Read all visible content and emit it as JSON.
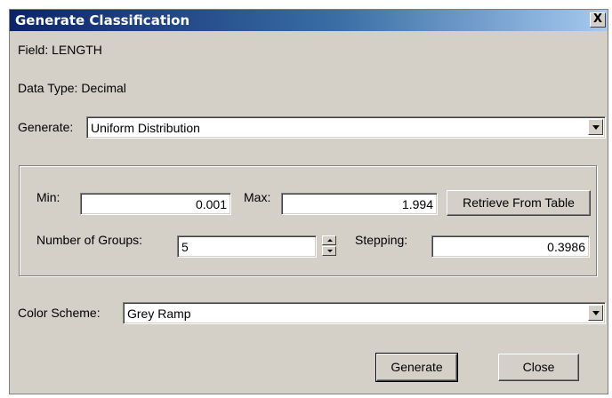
{
  "window": {
    "title": "Generate Classification",
    "close_glyph": "X"
  },
  "field_info": {
    "field": "Field: LENGTH",
    "data_type": "Data Type: Decimal"
  },
  "generate": {
    "label": "Generate:",
    "selected": "Uniform Distribution"
  },
  "range": {
    "min_label": "Min:",
    "min_value": "0.001",
    "max_label": "Max:",
    "max_value": "1.994",
    "retrieve_label": "Retrieve From Table",
    "groups_label": "Number of Groups:",
    "groups_value": "5",
    "stepping_label": "Stepping:",
    "stepping_value": "0.3986"
  },
  "color_scheme": {
    "label": "Color Scheme:",
    "selected": "Grey Ramp"
  },
  "buttons": {
    "generate_label": "Generate",
    "close_label": "Close"
  },
  "icons": [
    "close-icon",
    "chevron-down-icon",
    "spin-up-icon",
    "spin-down-icon"
  ]
}
